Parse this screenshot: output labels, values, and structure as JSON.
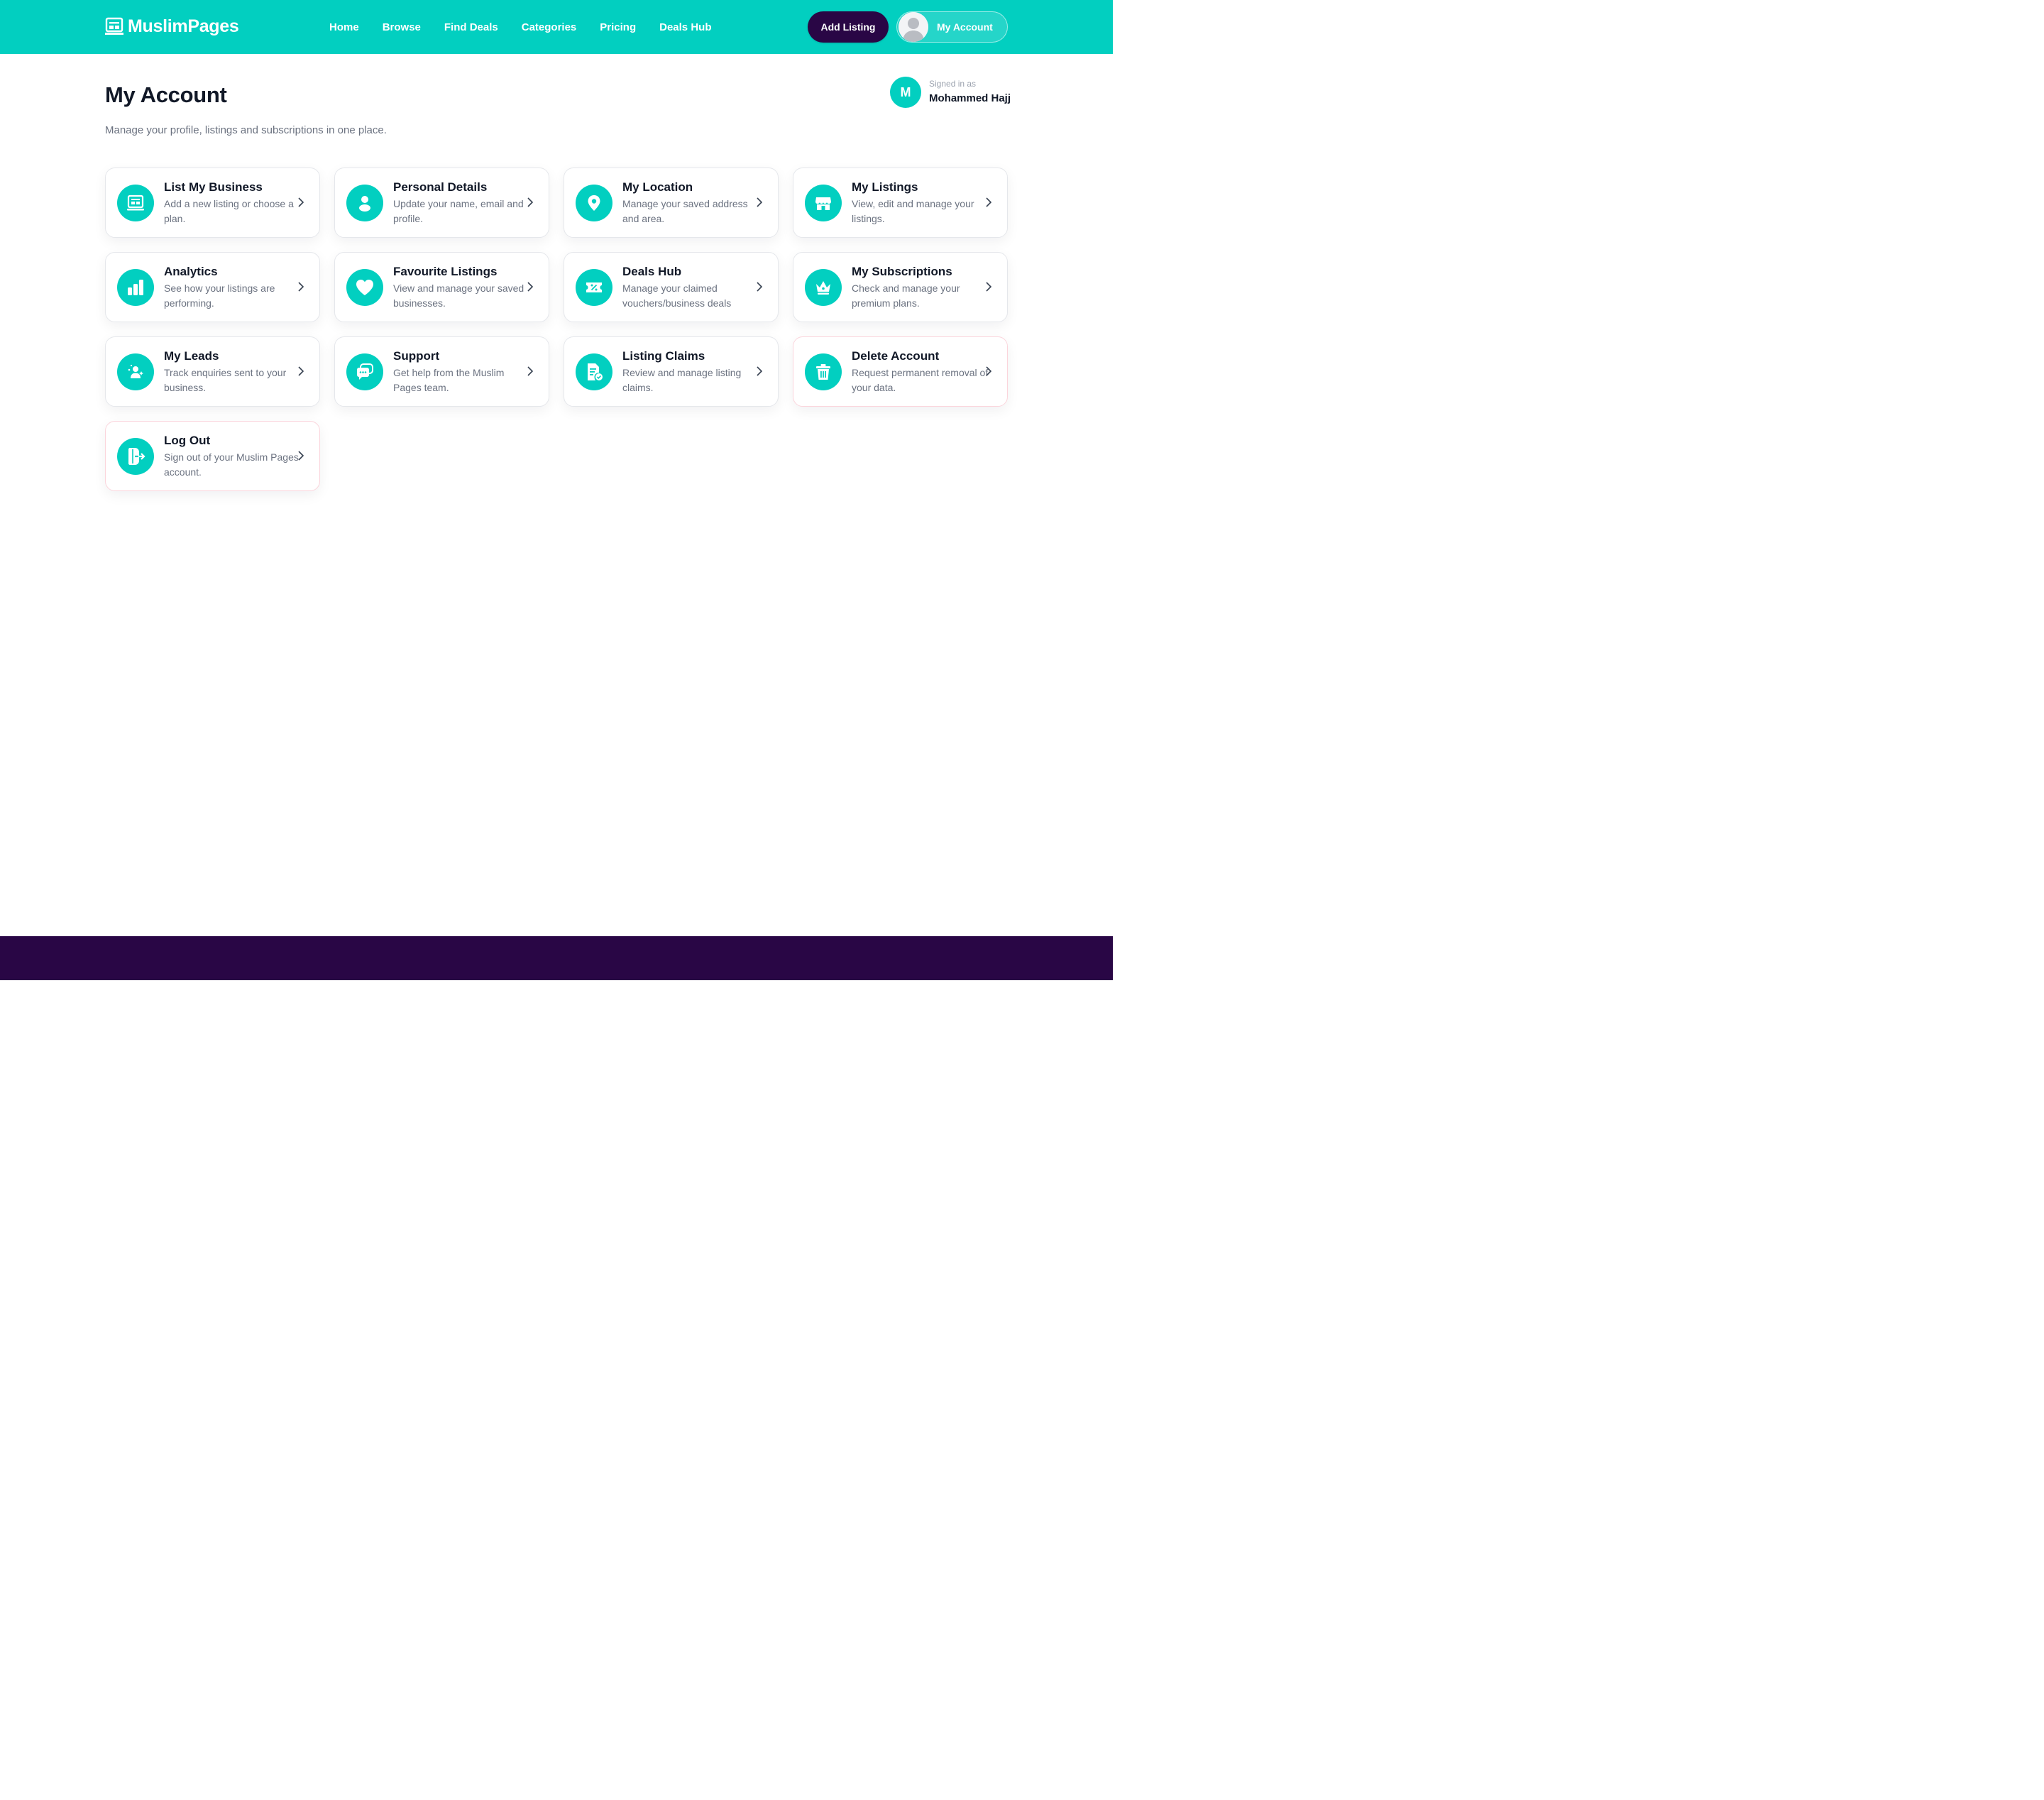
{
  "header": {
    "brand": "MuslimPages",
    "nav": [
      "Home",
      "Browse",
      "Find Deals",
      "Categories",
      "Pricing",
      "Deals Hub"
    ],
    "add_listing": "Add Listing",
    "account": "My Account"
  },
  "page": {
    "title": "My Account",
    "subtitle": "Manage your profile, listings and subscriptions in one place.",
    "signed_in_label": "Signed in as",
    "user_initial": "M",
    "user_name": "Mohammed Hajj"
  },
  "cards": [
    {
      "title": "List My Business",
      "desc": "Add a new listing or choose a plan.",
      "icon": "business-listing-icon"
    },
    {
      "title": "Personal Details",
      "desc": "Update your name, email and profile.",
      "icon": "user-icon"
    },
    {
      "title": "My Location",
      "desc": "Manage your saved address and area.",
      "icon": "location-pin-icon"
    },
    {
      "title": "My Listings",
      "desc": "View, edit and manage your listings.",
      "icon": "storefront-icon"
    },
    {
      "title": "Analytics",
      "desc": "See how your listings are performing.",
      "icon": "bar-chart-icon"
    },
    {
      "title": "Favourite Listings",
      "desc": "View and manage your saved businesses.",
      "icon": "heart-icon"
    },
    {
      "title": "Deals Hub",
      "desc": "Manage your claimed vouchers/business deals",
      "icon": "voucher-icon"
    },
    {
      "title": "My Subscriptions",
      "desc": "Check and manage your premium plans.",
      "icon": "crown-icon"
    },
    {
      "title": "My Leads",
      "desc": "Track enquiries sent to your business.",
      "icon": "leads-icon"
    },
    {
      "title": "Support",
      "desc": "Get help from the Muslim Pages team.",
      "icon": "chat-bubbles-icon"
    },
    {
      "title": "Listing Claims",
      "desc": "Review and manage listing claims.",
      "icon": "document-check-icon"
    },
    {
      "title": "Delete Account",
      "desc": "Request permanent removal of your data.",
      "icon": "trash-icon"
    },
    {
      "title": "Log Out",
      "desc": "Sign out of your Muslim Pages account.",
      "icon": "logout-icon"
    }
  ],
  "colors": {
    "brand": "#02cfc0",
    "dark": "#290645",
    "danger_border": "#fbd5dc"
  }
}
